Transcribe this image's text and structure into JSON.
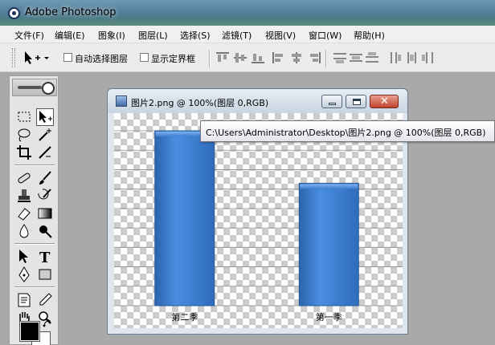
{
  "app": {
    "title": "Adobe Photoshop"
  },
  "menu": [
    "文件(F)",
    "编辑(E)",
    "图象(I)",
    "图层(L)",
    "选择(S)",
    "滤镜(T)",
    "视图(V)",
    "窗口(W)",
    "帮助(H)"
  ],
  "options": {
    "auto_select": "自动选择图层",
    "show_bounds": "显示定界框"
  },
  "document": {
    "title": "图片2.png @ 100%(图层 0,RGB)",
    "tooltip": "C:\\Users\\Administrator\\Desktop\\图片2.png @ 100%(图层 0,RGB)"
  },
  "colors": {
    "foreground": "#000000",
    "background": "#ffffff",
    "bar": "#3f7fd0"
  },
  "chart_data": {
    "type": "bar",
    "categories": [
      "第二季",
      "第一季"
    ],
    "values": [
      2.0,
      1.4
    ],
    "title": "",
    "xlabel": "",
    "ylabel": "",
    "ylim": [
      0,
      2.0
    ],
    "grid": true,
    "legend": "none"
  }
}
